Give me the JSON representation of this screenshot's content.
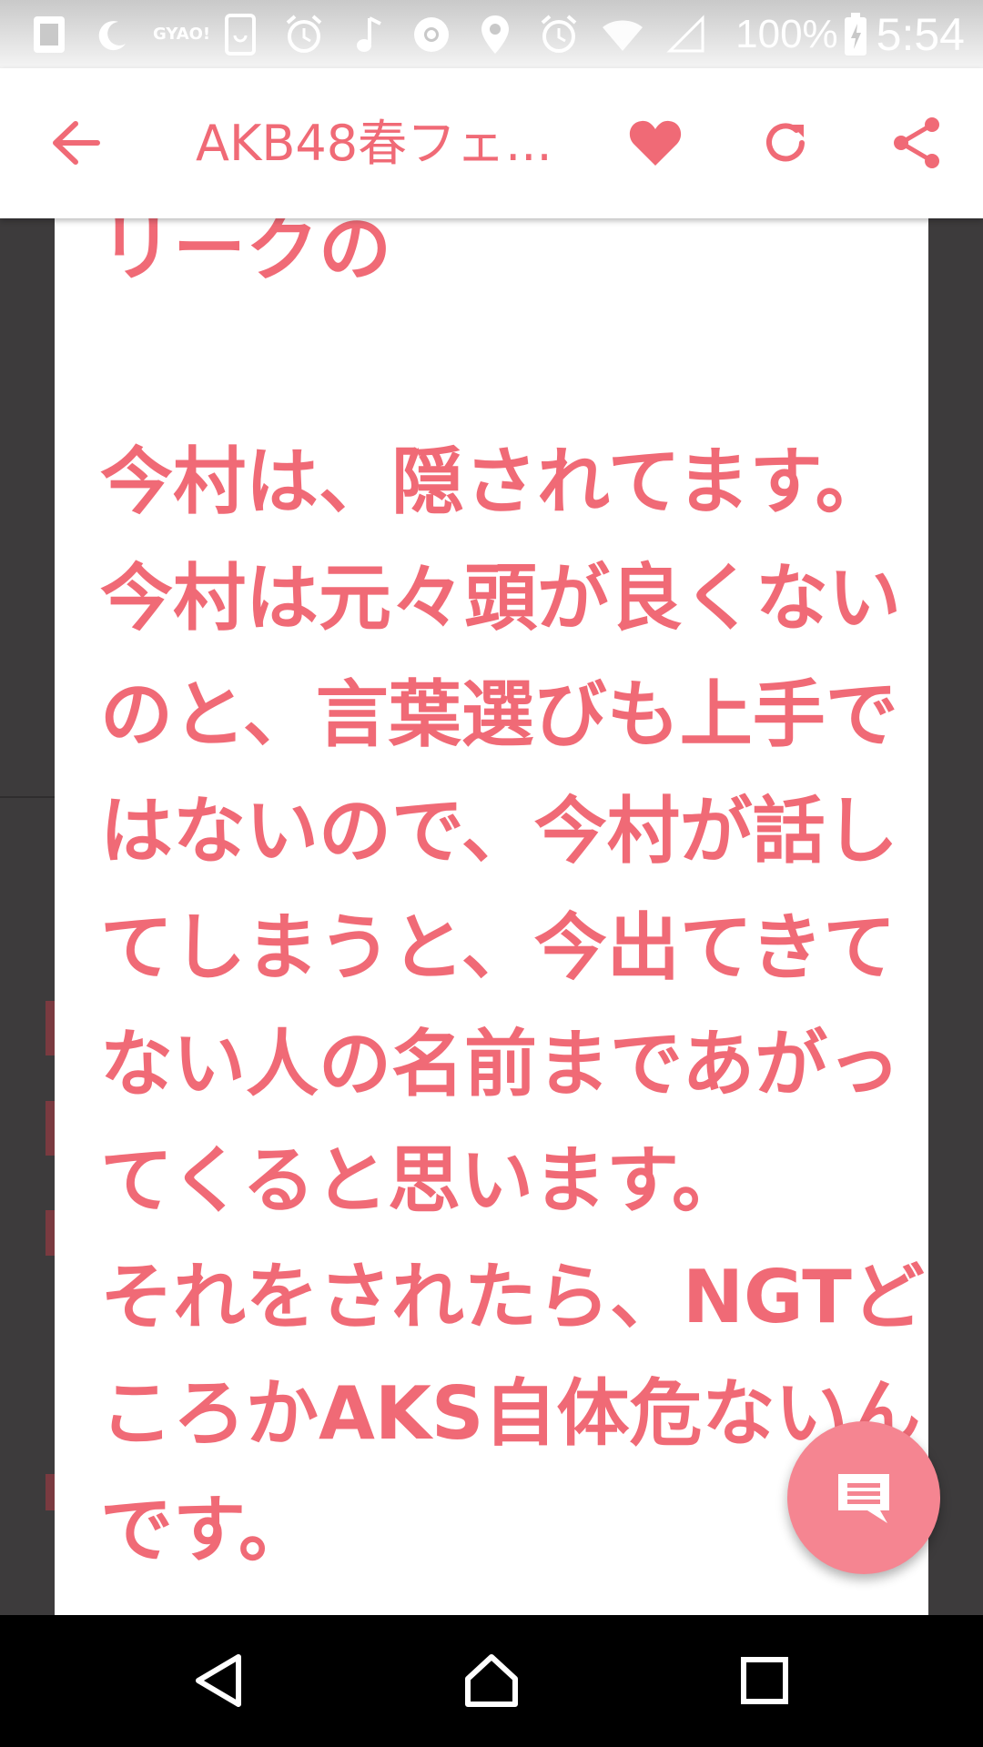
{
  "status_bar": {
    "icons": [
      "sim-icon",
      "moon-icon",
      "gyao-icon",
      "tablet-icon",
      "alarm-icon",
      "music-note-icon",
      "chrome-icon",
      "location-icon",
      "alarm-icon",
      "wifi-icon",
      "cell-signal-icon",
      "battery-charging-icon"
    ],
    "gyao_label": "GYAO!",
    "battery": "100%",
    "time": "5:54"
  },
  "app_bar": {
    "title": "AKB48春フェ...",
    "back_icon": "arrow-left-icon",
    "favorite_icon": "heart-icon",
    "reload_icon": "reload-icon",
    "share_icon": "share-icon"
  },
  "post": {
    "lines": [
      "リークの",
      "",
      "今村は、隠されてます。",
      "今村は元々頭が良くない",
      "のと、言葉選びも上手で",
      "はないので、今村が話し",
      "てしまうと、今出てきて",
      "ない人の名前まであがっ",
      "てくると思います。",
      "それをされたら、NGTど",
      "ころかAKS自体危ないん",
      "です。"
    ]
  },
  "fab": {
    "icon": "comment-icon"
  },
  "nav_bar": {
    "back_icon": "nav-back-icon",
    "home_icon": "nav-home-icon",
    "recents_icon": "nav-recents-icon"
  },
  "colors": {
    "accent": "#f06a76",
    "fab": "#f58591",
    "background": "#3d3b3c",
    "card": "#ffffff",
    "nav": "#000000"
  }
}
